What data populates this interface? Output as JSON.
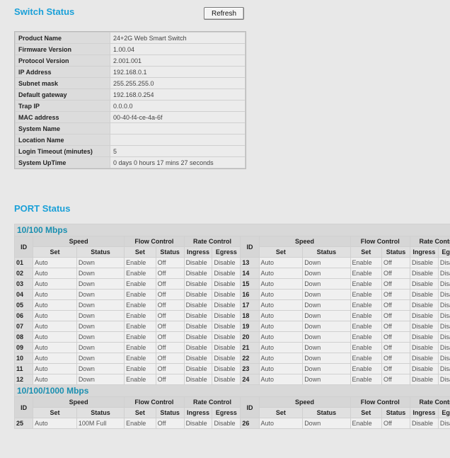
{
  "switch_status": {
    "title": "Switch Status",
    "refresh_label": "Refresh",
    "rows": [
      {
        "label": "Product Name",
        "value": "24+2G Web Smart Switch"
      },
      {
        "label": "Firmware Version",
        "value": "1.00.04"
      },
      {
        "label": "Protocol Version",
        "value": "2.001.001"
      },
      {
        "label": "IP Address",
        "value": "192.168.0.1"
      },
      {
        "label": "Subnet mask",
        "value": "255.255.255.0"
      },
      {
        "label": "Default gateway",
        "value": "192.168.0.254"
      },
      {
        "label": "Trap IP",
        "value": "0.0.0.0"
      },
      {
        "label": "MAC address",
        "value": "00-40-f4-ce-4a-6f"
      },
      {
        "label": "System Name",
        "value": ""
      },
      {
        "label": "Location Name",
        "value": ""
      },
      {
        "label": "Login Timeout (minutes)",
        "value": "5"
      },
      {
        "label": "System UpTime",
        "value": "0 days 0 hours 17 mins 27 seconds"
      }
    ]
  },
  "port_status": {
    "title": "PORT Status",
    "headers": {
      "id": "ID",
      "speed": "Speed",
      "flow_control": "Flow Control",
      "rate_control": "Rate Control",
      "set": "Set",
      "status": "Status",
      "ingress": "Ingress",
      "egress": "Egress"
    },
    "sections": [
      {
        "title": "10/100 Mbps",
        "rows": [
          {
            "left": {
              "id": "01",
              "speed_set": "Auto",
              "speed_status": "Down",
              "flow_set": "Enable",
              "flow_status": "Off",
              "ingress": "Disable",
              "egress": "Disable"
            },
            "right": {
              "id": "13",
              "speed_set": "Auto",
              "speed_status": "Down",
              "flow_set": "Enable",
              "flow_status": "Off",
              "ingress": "Disable",
              "egress": "Disable"
            }
          },
          {
            "left": {
              "id": "02",
              "speed_set": "Auto",
              "speed_status": "Down",
              "flow_set": "Enable",
              "flow_status": "Off",
              "ingress": "Disable",
              "egress": "Disable"
            },
            "right": {
              "id": "14",
              "speed_set": "Auto",
              "speed_status": "Down",
              "flow_set": "Enable",
              "flow_status": "Off",
              "ingress": "Disable",
              "egress": "Disable"
            }
          },
          {
            "left": {
              "id": "03",
              "speed_set": "Auto",
              "speed_status": "Down",
              "flow_set": "Enable",
              "flow_status": "Off",
              "ingress": "Disable",
              "egress": "Disable"
            },
            "right": {
              "id": "15",
              "speed_set": "Auto",
              "speed_status": "Down",
              "flow_set": "Enable",
              "flow_status": "Off",
              "ingress": "Disable",
              "egress": "Disable"
            }
          },
          {
            "left": {
              "id": "04",
              "speed_set": "Auto",
              "speed_status": "Down",
              "flow_set": "Enable",
              "flow_status": "Off",
              "ingress": "Disable",
              "egress": "Disable"
            },
            "right": {
              "id": "16",
              "speed_set": "Auto",
              "speed_status": "Down",
              "flow_set": "Enable",
              "flow_status": "Off",
              "ingress": "Disable",
              "egress": "Disable"
            }
          },
          {
            "left": {
              "id": "05",
              "speed_set": "Auto",
              "speed_status": "Down",
              "flow_set": "Enable",
              "flow_status": "Off",
              "ingress": "Disable",
              "egress": "Disable"
            },
            "right": {
              "id": "17",
              "speed_set": "Auto",
              "speed_status": "Down",
              "flow_set": "Enable",
              "flow_status": "Off",
              "ingress": "Disable",
              "egress": "Disable"
            }
          },
          {
            "left": {
              "id": "06",
              "speed_set": "Auto",
              "speed_status": "Down",
              "flow_set": "Enable",
              "flow_status": "Off",
              "ingress": "Disable",
              "egress": "Disable"
            },
            "right": {
              "id": "18",
              "speed_set": "Auto",
              "speed_status": "Down",
              "flow_set": "Enable",
              "flow_status": "Off",
              "ingress": "Disable",
              "egress": "Disable"
            }
          },
          {
            "left": {
              "id": "07",
              "speed_set": "Auto",
              "speed_status": "Down",
              "flow_set": "Enable",
              "flow_status": "Off",
              "ingress": "Disable",
              "egress": "Disable"
            },
            "right": {
              "id": "19",
              "speed_set": "Auto",
              "speed_status": "Down",
              "flow_set": "Enable",
              "flow_status": "Off",
              "ingress": "Disable",
              "egress": "Disable"
            }
          },
          {
            "left": {
              "id": "08",
              "speed_set": "Auto",
              "speed_status": "Down",
              "flow_set": "Enable",
              "flow_status": "Off",
              "ingress": "Disable",
              "egress": "Disable"
            },
            "right": {
              "id": "20",
              "speed_set": "Auto",
              "speed_status": "Down",
              "flow_set": "Enable",
              "flow_status": "Off",
              "ingress": "Disable",
              "egress": "Disable"
            }
          },
          {
            "left": {
              "id": "09",
              "speed_set": "Auto",
              "speed_status": "Down",
              "flow_set": "Enable",
              "flow_status": "Off",
              "ingress": "Disable",
              "egress": "Disable"
            },
            "right": {
              "id": "21",
              "speed_set": "Auto",
              "speed_status": "Down",
              "flow_set": "Enable",
              "flow_status": "Off",
              "ingress": "Disable",
              "egress": "Disable"
            }
          },
          {
            "left": {
              "id": "10",
              "speed_set": "Auto",
              "speed_status": "Down",
              "flow_set": "Enable",
              "flow_status": "Off",
              "ingress": "Disable",
              "egress": "Disable"
            },
            "right": {
              "id": "22",
              "speed_set": "Auto",
              "speed_status": "Down",
              "flow_set": "Enable",
              "flow_status": "Off",
              "ingress": "Disable",
              "egress": "Disable"
            }
          },
          {
            "left": {
              "id": "11",
              "speed_set": "Auto",
              "speed_status": "Down",
              "flow_set": "Enable",
              "flow_status": "Off",
              "ingress": "Disable",
              "egress": "Disable"
            },
            "right": {
              "id": "23",
              "speed_set": "Auto",
              "speed_status": "Down",
              "flow_set": "Enable",
              "flow_status": "Off",
              "ingress": "Disable",
              "egress": "Disable"
            }
          },
          {
            "left": {
              "id": "12",
              "speed_set": "Auto",
              "speed_status": "Down",
              "flow_set": "Enable",
              "flow_status": "Off",
              "ingress": "Disable",
              "egress": "Disable"
            },
            "right": {
              "id": "24",
              "speed_set": "Auto",
              "speed_status": "Down",
              "flow_set": "Enable",
              "flow_status": "Off",
              "ingress": "Disable",
              "egress": "Disable"
            }
          }
        ]
      },
      {
        "title": "10/100/1000 Mbps",
        "rows": [
          {
            "left": {
              "id": "25",
              "speed_set": "Auto",
              "speed_status": "100M Full",
              "flow_set": "Enable",
              "flow_status": "Off",
              "ingress": "Disable",
              "egress": "Disable"
            },
            "right": {
              "id": "26",
              "speed_set": "Auto",
              "speed_status": "Down",
              "flow_set": "Enable",
              "flow_status": "Off",
              "ingress": "Disable",
              "egress": "Disable"
            }
          }
        ]
      }
    ]
  }
}
